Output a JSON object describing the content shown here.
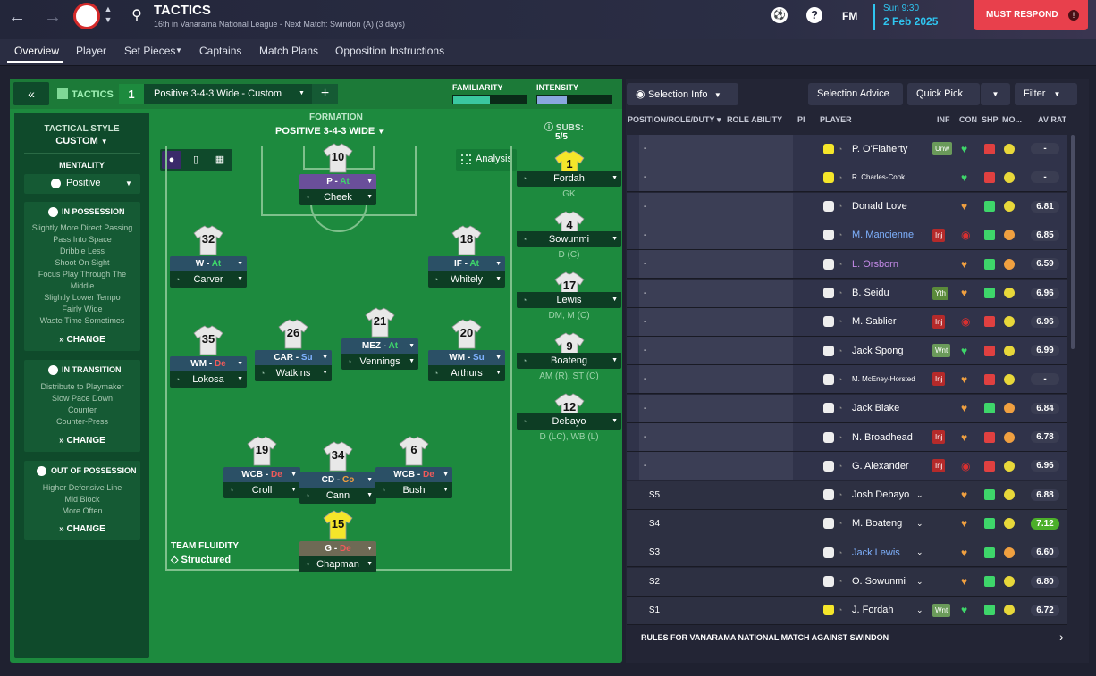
{
  "topbar": {
    "title": "TACTICS",
    "subtitle": "16th in Vanarama National League - Next Match: Swindon (A) (3 days)",
    "day": "Sun 9:30",
    "date": "2 Feb 2025",
    "fm": "FM",
    "must_respond": "MUST RESPOND"
  },
  "tabs": [
    "Overview",
    "Player",
    "Set Pieces",
    "Captains",
    "Match Plans",
    "Opposition Instructions"
  ],
  "tactics_header": {
    "label": "TACTICS",
    "slot": "1",
    "tactic_name": "Positive 3-4-3 Wide - Custom",
    "familiarity": "FAMILIARITY",
    "intensity": "INTENSITY",
    "familiarity_level": 0.5,
    "intensity_level": 0.4
  },
  "style": {
    "heading": "TACTICAL STYLE",
    "value": "CUSTOM",
    "mentality_label": "MENTALITY",
    "mentality": "Positive",
    "in_possession": {
      "title": "IN POSSESSION",
      "items": [
        "Slightly More Direct Passing",
        "Pass Into Space",
        "Dribble Less",
        "Shoot On Sight",
        "Focus Play Through The",
        "Middle",
        "Slightly Lower Tempo",
        "Fairly Wide",
        "Waste Time Sometimes"
      ],
      "change": "CHANGE"
    },
    "in_transition": {
      "title": "IN TRANSITION",
      "items": [
        "Distribute to Playmaker",
        "Slow Pace Down",
        "Counter",
        "Counter-Press"
      ],
      "change": "CHANGE"
    },
    "out_of_possession": {
      "title": "OUT OF POSSESSION",
      "items": [
        "Higher Defensive Line",
        "Mid Block",
        "More Often"
      ],
      "change": "CHANGE"
    }
  },
  "formation": {
    "label": "FORMATION",
    "name": "POSITIVE 3-4-3 WIDE",
    "analysis": "Analysis",
    "fluidity_label": "TEAM FLUIDITY",
    "fluidity": "Structured"
  },
  "lineup": [
    {
      "num": "10",
      "role": "P",
      "duty": "At",
      "name": "Cheek"
    },
    {
      "num": "32",
      "role": "W",
      "duty": "At",
      "name": "Carver"
    },
    {
      "num": "18",
      "role": "IF",
      "duty": "At",
      "name": "Whitely"
    },
    {
      "num": "35",
      "role": "WM",
      "duty": "De",
      "name": "Lokosa"
    },
    {
      "num": "26",
      "role": "CAR",
      "duty": "Su",
      "name": "Watkins"
    },
    {
      "num": "21",
      "role": "MEZ",
      "duty": "At",
      "name": "Vennings"
    },
    {
      "num": "20",
      "role": "WM",
      "duty": "Su",
      "name": "Arthurs"
    },
    {
      "num": "19",
      "role": "WCB",
      "duty": "De",
      "name": "Croll"
    },
    {
      "num": "34",
      "role": "CD",
      "duty": "Co",
      "name": "Cann"
    },
    {
      "num": "6",
      "role": "WCB",
      "duty": "De",
      "name": "Bush"
    },
    {
      "num": "15",
      "role": "G",
      "duty": "De",
      "name": "Chapman"
    }
  ],
  "subs": {
    "label": "SUBS:",
    "count": "5/5",
    "players": [
      {
        "num": "1",
        "name": "Fordah",
        "pos": "GK"
      },
      {
        "num": "4",
        "name": "Sowunmi",
        "pos": "D (C)"
      },
      {
        "num": "17",
        "name": "Lewis",
        "pos": "DM, M (C)"
      },
      {
        "num": "9",
        "name": "Boateng",
        "pos": "AM (R), ST (C)"
      },
      {
        "num": "12",
        "name": "Debayo",
        "pos": "D (LC), WB (L)"
      }
    ]
  },
  "right": {
    "selection_info": "Selection Info",
    "selection_advice": "Selection Advice",
    "quick_pick": "Quick Pick",
    "filter": "Filter",
    "headers": [
      "POSITION/ROLE/DUTY",
      "ROLE ABILITY",
      "PI",
      "PLAYER",
      "INF",
      "CON",
      "SHP",
      "MO...",
      "AV RAT"
    ],
    "rows": [
      {
        "pos": "-",
        "player": "P. O'Flaherty",
        "inf": "Unw",
        "rat": "-"
      },
      {
        "pos": "-",
        "player": "R. Charles-Cook",
        "inf": "",
        "rat": "-"
      },
      {
        "pos": "-",
        "player": "Donald Love",
        "inf": "",
        "rat": "6.81"
      },
      {
        "pos": "-",
        "player": "M. Mancienne",
        "inf": "Inj",
        "rat": "6.85"
      },
      {
        "pos": "-",
        "player": "L. Orsborn",
        "inf": "",
        "rat": "6.59"
      },
      {
        "pos": "-",
        "player": "B. Seidu",
        "inf": "Yth",
        "rat": "6.96"
      },
      {
        "pos": "-",
        "player": "M. Sablier",
        "inf": "Inj",
        "rat": "6.96"
      },
      {
        "pos": "-",
        "player": "Jack Spong",
        "inf": "Wnt",
        "rat": "6.99"
      },
      {
        "pos": "-",
        "player": "M. McEney-Horsted",
        "inf": "Inj",
        "rat": "-"
      },
      {
        "pos": "-",
        "player": "Jack Blake",
        "inf": "",
        "rat": "6.84"
      },
      {
        "pos": "-",
        "player": "N. Broadhead",
        "inf": "Inj",
        "rat": "6.78"
      },
      {
        "pos": "-",
        "player": "G. Alexander",
        "inf": "Inj",
        "rat": "6.96"
      },
      {
        "pos": "S5",
        "player": "Josh Debayo",
        "inf": "",
        "rat": "6.88"
      },
      {
        "pos": "S4",
        "player": "M. Boateng",
        "inf": "",
        "rat": "7.12"
      },
      {
        "pos": "S3",
        "player": "Jack Lewis",
        "inf": "",
        "rat": "6.60"
      },
      {
        "pos": "S2",
        "player": "O. Sowunmi",
        "inf": "",
        "rat": "6.80"
      },
      {
        "pos": "S1",
        "player": "J. Fordah",
        "inf": "Wnt",
        "rat": "6.72"
      }
    ],
    "rules": "RULES FOR VANARAMA NATIONAL MATCH AGAINST SWINDON"
  },
  "colors": {
    "pitch": "#1d8a3e",
    "accent": "#e8404c",
    "date": "#2fc5f0",
    "at": "#3ed66a",
    "de": "#f05a5a",
    "su": "#7fb2ff",
    "co": "#f0a040"
  }
}
